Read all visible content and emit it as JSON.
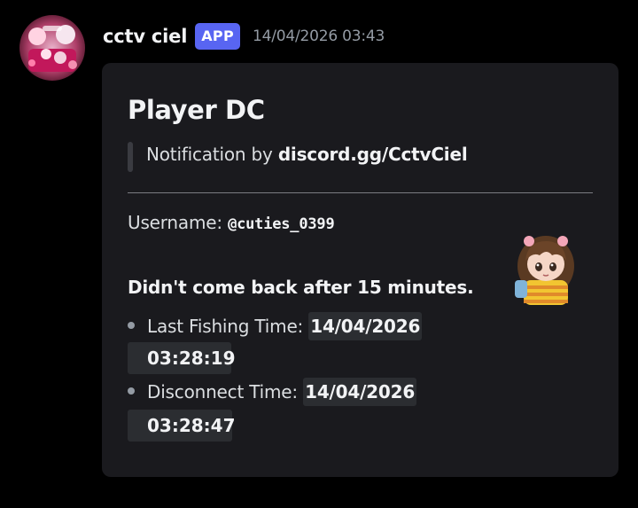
{
  "message": {
    "author": "cctv ciel",
    "badge": "APP",
    "timestamp": "14/04/2026 03:43"
  },
  "embed": {
    "title": "Player DC",
    "description_prefix": "Notification by ",
    "description_link": "discord.gg/CctvCiel",
    "username_label": "Username: ",
    "username_value": "@cuties_0399",
    "status_line": "Didn't come back after 15 minutes.",
    "fields": [
      {
        "label": "Last Fishing Time: ",
        "date": "14/04/2026",
        "time": "03:28:19"
      },
      {
        "label": "Disconnect Time: ",
        "date": "14/04/2026",
        "time": "03:28:47"
      }
    ]
  },
  "colors": {
    "background": "#000000",
    "embed_background": "#1a1a1e",
    "app_badge": "#5865f2",
    "timestamp": "#949ba4",
    "code_background": "#2b2d31"
  },
  "icons": {
    "avatar": "bot-avatar-image",
    "thumbnail": "player-avatar-thumbnail"
  }
}
